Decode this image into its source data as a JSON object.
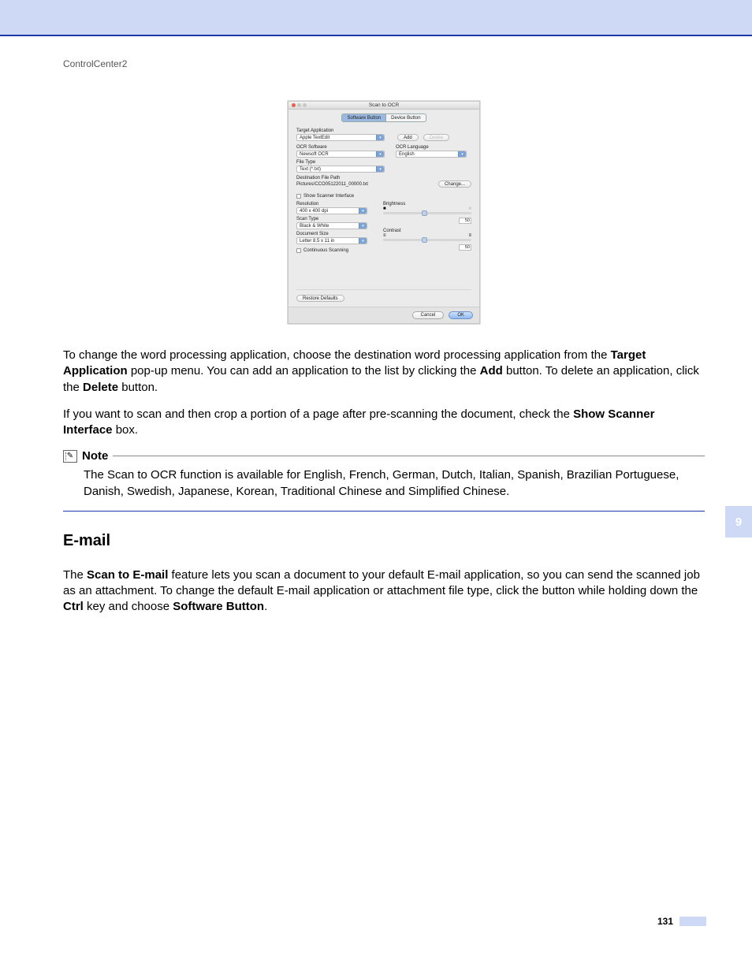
{
  "header_label": "ControlCenter2",
  "side_tab": "9",
  "page_number": "131",
  "screenshot": {
    "title": "Scan to OCR",
    "tabs": {
      "software": "Software Button",
      "device": "Device Button"
    },
    "labels": {
      "target_app": "Target Application",
      "ocr_software": "OCR Software",
      "ocr_language": "OCR Language",
      "file_type": "File Type",
      "dest_path": "Destination File Path",
      "show_scanner": "Show Scanner Interface",
      "resolution": "Resolution",
      "scan_type": "Scan Type",
      "doc_size": "Document Size",
      "continuous": "Continuous Scanning",
      "brightness": "Brightness",
      "contrast": "Contrast"
    },
    "values": {
      "target_app": "Apple TextEdit",
      "ocr_software": "Newsoft OCR",
      "ocr_language": "English",
      "file_type": "Text (*.txt)",
      "dest_path": "Pictures/CCO05122011_00000.txt",
      "resolution": "400 x 400 dpi",
      "scan_type": "Black & White",
      "doc_size": "Letter 8.5 x 11 in",
      "brightness": "50",
      "contrast": "50"
    },
    "buttons": {
      "add": "Add",
      "delete": "Delete",
      "change": "Change...",
      "restore": "Restore Defaults",
      "cancel": "Cancel",
      "ok": "OK"
    }
  },
  "para1": {
    "t1": "To change the word processing application, choose the destination word processing application from the ",
    "b1": "Target Application",
    "t2": " pop-up menu. You can add an application to the list by clicking the ",
    "b2": "Add",
    "t3": " button. To delete an application, click the ",
    "b3": "Delete",
    "t4": " button."
  },
  "para2": {
    "t1": "If you want to scan and then crop a portion of a page after pre-scanning the document, check the ",
    "b1": "Show Scanner Interface",
    "t2": " box."
  },
  "note": {
    "label": "Note",
    "body": "The Scan to OCR function is available for English, French, German, Dutch, Italian, Spanish, Brazilian Portuguese, Danish, Swedish, Japanese, Korean, Traditional Chinese and Simplified Chinese."
  },
  "section_heading": "E-mail",
  "para3": {
    "t1": "The ",
    "b1": "Scan to E-mail",
    "t2": " feature lets you scan a document to your default E-mail application, so you can send the scanned job as an attachment. To change the default E-mail application or attachment file type, click the button while holding down the ",
    "b2": "Ctrl",
    "t3": " key and choose ",
    "b3": "Software Button",
    "t4": "."
  }
}
